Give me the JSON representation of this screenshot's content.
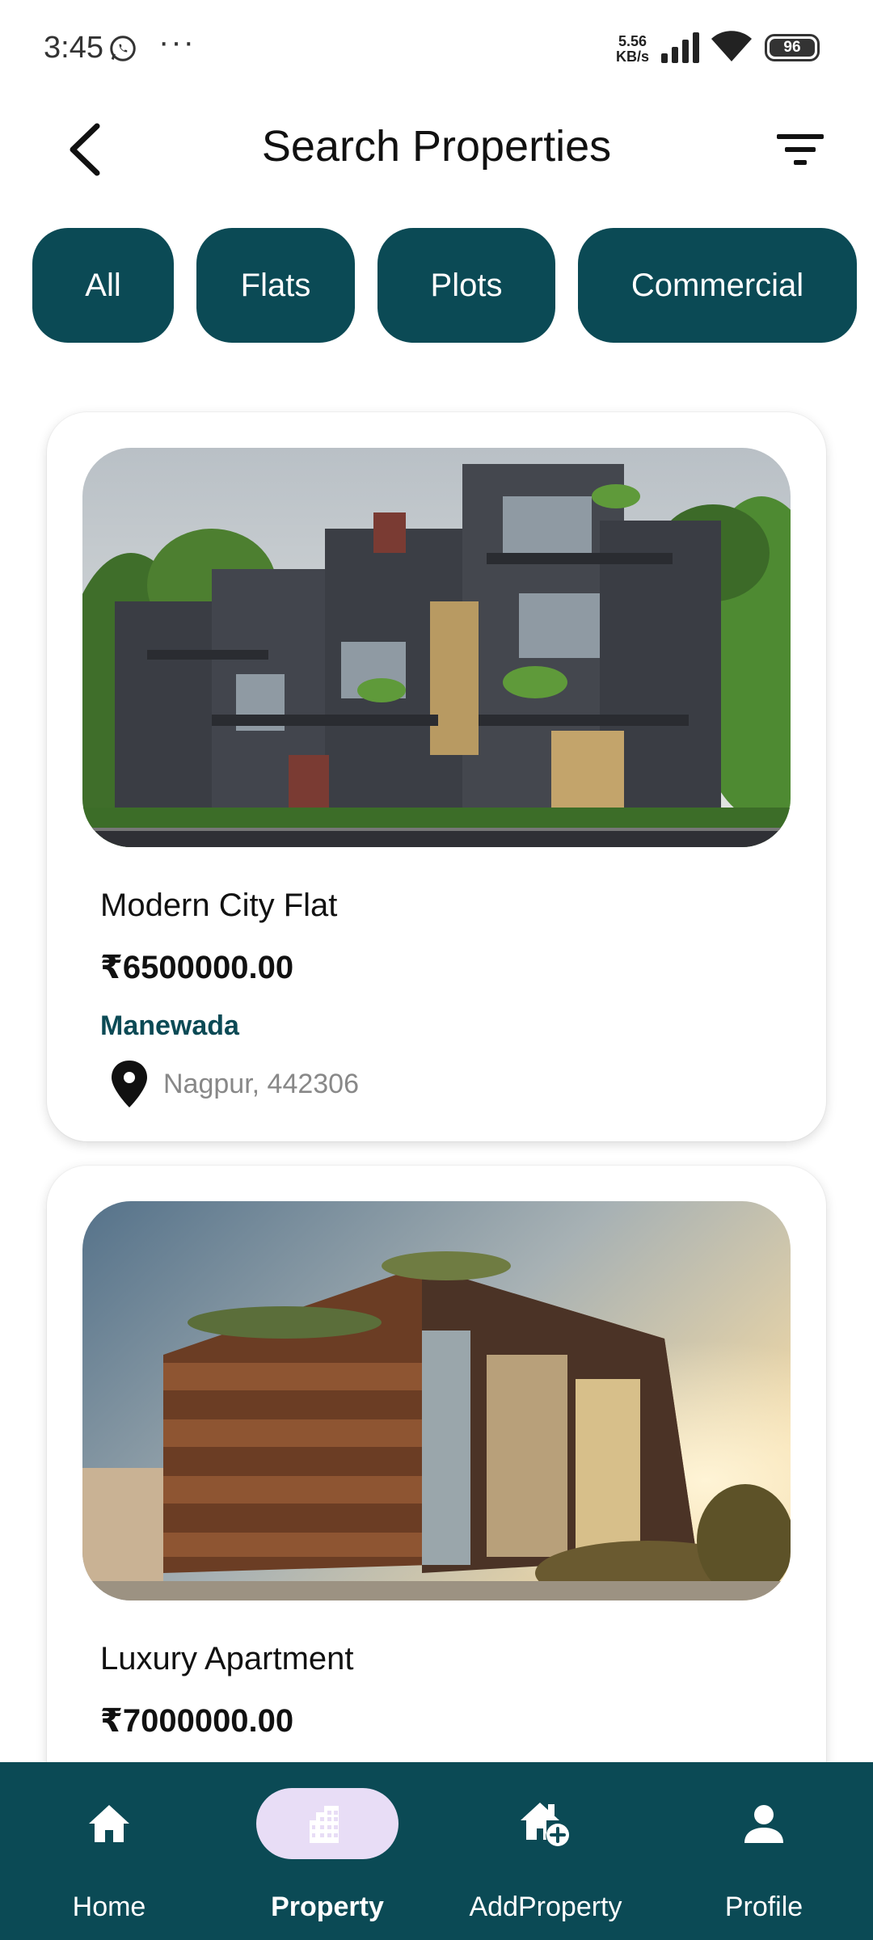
{
  "status_bar": {
    "time": "3:45",
    "dots": "···",
    "speed_value": "5.56",
    "speed_unit": "KB/s",
    "battery": "96"
  },
  "header": {
    "title": "Search Properties"
  },
  "filters": [
    {
      "label": "All"
    },
    {
      "label": "Flats"
    },
    {
      "label": "Plots"
    },
    {
      "label": "Commercial"
    }
  ],
  "properties": [
    {
      "title": "Modern City Flat",
      "price": "₹6500000.00",
      "area": "Manewada",
      "location": "Nagpur, 442306"
    },
    {
      "title": "Luxury Apartment",
      "price": "₹7000000.00"
    }
  ],
  "bottom_nav": [
    {
      "label": "Home",
      "icon": "home-icon",
      "active": false
    },
    {
      "label": "Property",
      "icon": "building-icon",
      "active": true
    },
    {
      "label": "AddProperty",
      "icon": "add-home-icon",
      "active": false
    },
    {
      "label": "Profile",
      "icon": "person-icon",
      "active": false
    }
  ],
  "colors": {
    "primary": "#0b4a55",
    "active_pill": "#e8ddf6",
    "muted_text": "#888888"
  }
}
